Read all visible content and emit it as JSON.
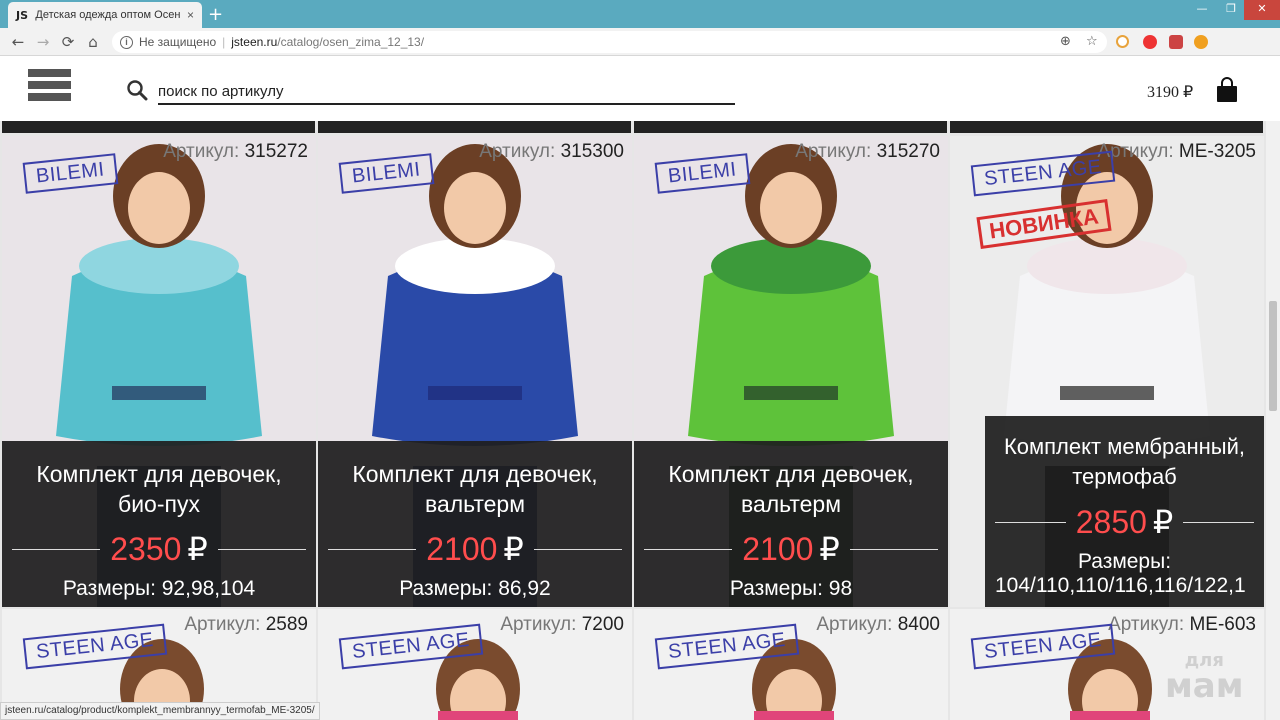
{
  "browser": {
    "tab_favicon": "JS",
    "tab_title": "Детская одежда оптом Осень-З",
    "tab_close": "×",
    "new_tab": "+",
    "win_min": "—",
    "win_max": "❐",
    "win_close": "✕",
    "back": "←",
    "forward": "→",
    "reload": "⟳",
    "home": "⌂",
    "security_label": "Не защищено",
    "separator": "|",
    "url_host": "jsteen.ru",
    "url_path": "/catalog/osen_zima_12_13/",
    "zoom_icon": "⊕",
    "bookmark_icon": "☆",
    "profile_icon": "●",
    "menu_icon": "⋮",
    "status_url": "jsteen.ru/catalog/product/komplekt_membrannyy_termofab_ME-3205/"
  },
  "header": {
    "search_placeholder": "поиск по артикулу",
    "cart_total": "3190 ₽"
  },
  "sku_label": "Артикул:",
  "products": [
    {
      "sku": "315272",
      "brand": "BILEMI",
      "name_1": "Комплект для девочек,",
      "name_2": "био-пух",
      "price": "2350",
      "currency": "₽",
      "sizes": "Размеры: 92,98,104",
      "colors": {
        "bg": "#e9e4e8",
        "coat": "#56bfcc",
        "pants": "#24305a",
        "fur": "#8fd6e0"
      }
    },
    {
      "sku": "315300",
      "brand": "BILEMI",
      "name_1": "Комплект для девочек,",
      "name_2": "вальтерм",
      "price": "2100",
      "currency": "₽",
      "sizes": "Размеры: 86,92",
      "colors": {
        "bg": "#e9e4e8",
        "coat": "#2a4aa8",
        "pants": "#1e2a78",
        "fur": "#ffffff"
      }
    },
    {
      "sku": "315270",
      "brand": "BILEMI",
      "name_1": "Комплект для девочек,",
      "name_2": "вальтерм",
      "price": "2100",
      "currency": "₽",
      "sizes": "Размеры: 98",
      "colors": {
        "bg": "#e9e4e8",
        "coat": "#5ec23a",
        "pants": "#213828",
        "fur": "#3c9a3a"
      }
    },
    {
      "sku": "ME-3205",
      "brand": "STEEN AGE",
      "badge": "НОВИНКА",
      "name_1": "Комплект мембранный,",
      "name_2": "термофаб",
      "price": "2850",
      "currency": "₽",
      "sizes": "Размеры:",
      "sizes_2": "104/110,110/116,116/122,1",
      "colors": {
        "bg": "#ececec",
        "coat": "#f4f4f6",
        "pants": "#202020",
        "fur": "#f0e6ea"
      }
    }
  ],
  "products_row2": [
    {
      "sku": "2589",
      "brand": "STEEN AGE"
    },
    {
      "sku": "7200",
      "brand": "STEEN AGE"
    },
    {
      "sku": "8400",
      "brand": "STEEN AGE"
    },
    {
      "sku": "ME-603",
      "brand": "STEEN AGE"
    }
  ],
  "watermark": {
    "top": "для",
    "bottom": "мам"
  }
}
